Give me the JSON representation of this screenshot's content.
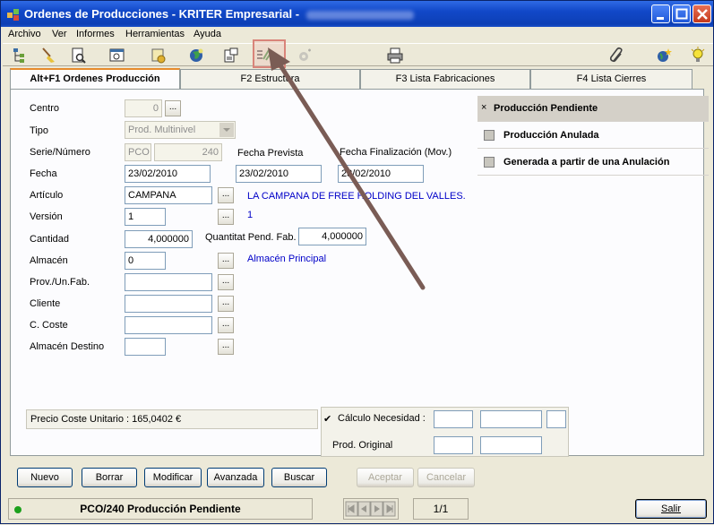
{
  "window": {
    "title": "Ordenes de Producciones - KRITER Empresarial - ",
    "controls": [
      "minimize",
      "maximize",
      "close"
    ]
  },
  "menu": [
    "Archivo",
    "Ver",
    "Informes",
    "Herramientas",
    "Ayuda"
  ],
  "toolbar": {
    "icons": [
      "tree-icon",
      "broom-icon",
      "preview-icon",
      "search-doc-icon",
      "coins-icon",
      "globe-icon",
      "doc-key-icon",
      "checklist-icon",
      "settings-disabled-icon",
      "printer-icon",
      "paperclip-icon",
      "globe-star-icon",
      "lightbulb-icon"
    ]
  },
  "tabs": [
    {
      "label": "Alt+F1 Ordenes Producción"
    },
    {
      "label": "F2 Estructura"
    },
    {
      "label": "F3 Lista Fabricaciones"
    },
    {
      "label": "F4 Lista Cierres"
    }
  ],
  "form": {
    "centro_label": "Centro",
    "centro_value": "0",
    "tipo_label": "Tipo",
    "tipo_value": "Prod. Multinivel",
    "serie_label": "Serie/Número",
    "serie_value": "PCO",
    "numero_value": "240",
    "fecha_label": "Fecha",
    "fecha_value": "23/02/2010",
    "fecha_prevista_label": "Fecha Prevista",
    "fecha_prevista_value": "23/02/2010",
    "fecha_fin_label": "Fecha Finalización (Mov.)",
    "fecha_fin_value": "23/02/2010",
    "articulo_label": "Artículo",
    "articulo_value": "CAMPANA",
    "articulo_desc": "LA CAMPANA DE FREE HOLDING DEL VALLES.",
    "version_label": "Versión",
    "version_value": "1",
    "version_desc": "1",
    "cantidad_label": "Cantidad",
    "cantidad_value": "4,000000",
    "quantitat_label": "Quantitat Pend. Fab.",
    "quantitat_value": "4,000000",
    "almacen_label": "Almacén",
    "almacen_value": "0",
    "almacen_desc": "Almacén Principal",
    "prov_label": "Prov./Un.Fab.",
    "cliente_label": "Cliente",
    "coste_label": "C. Coste",
    "almacen_dest_label": "Almacén Destino",
    "dots": "..."
  },
  "status_options": [
    {
      "label": "Producción Pendiente",
      "mark": "×",
      "selected": true
    },
    {
      "label": "Producción Anulada",
      "selected": false
    },
    {
      "label": "Generada a partir de una Anulación",
      "selected": false
    }
  ],
  "info": {
    "precio": "Precio Coste Unitario : 165,0402 €",
    "calculo_mark": "✔",
    "calculo_label": "Cálculo Necesidad :",
    "prod_original_label": "Prod. Original"
  },
  "buttons": {
    "nuevo": "Nuevo",
    "borrar": "Borrar",
    "modificar": "Modificar",
    "avanzada": "Avanzada",
    "buscar": "Buscar",
    "aceptar": "Aceptar",
    "cancelar": "Cancelar"
  },
  "statusbar": {
    "record": "PCO/240 Producción Pendiente",
    "page": "1/1",
    "salir": "Salir"
  },
  "colors": {
    "accent": "#0A246A",
    "link": "#0000C8",
    "annotation_arrow": "#7A5C55"
  }
}
